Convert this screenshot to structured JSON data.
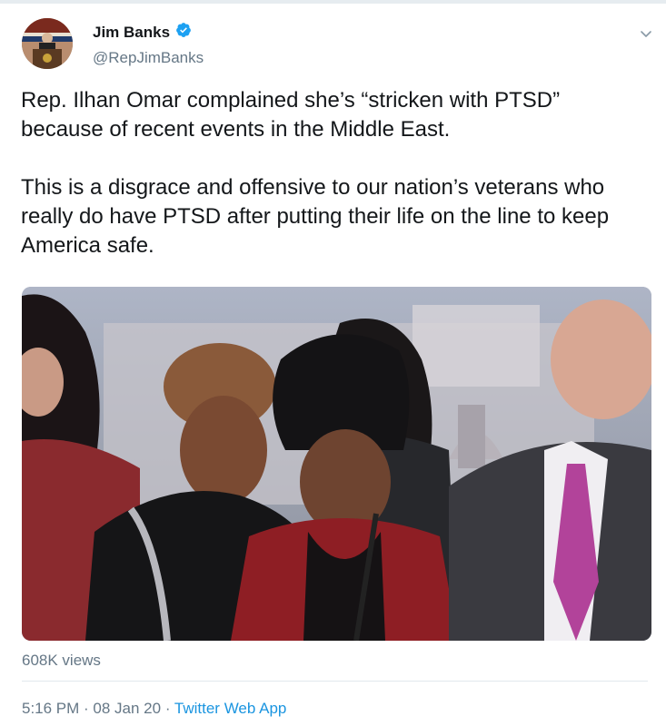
{
  "tweet": {
    "author": {
      "display_name": "Jim Banks",
      "handle": "@RepJimBanks",
      "verified": true
    },
    "text_paragraphs": [
      "Rep. Ilhan Omar complained she’s “stricken with PTSD” because of recent events in the Middle East.",
      "This is a disgrace and offensive to our nation’s veterans who really do have PTSD after putting their life on the line to keep America safe."
    ],
    "views": "608K views",
    "timestamp": "5:16 PM · 08 Jan 20 · ",
    "source_app": "Twitter Web App"
  },
  "colors": {
    "text": "#14171a",
    "secondary": "#657786",
    "link": "#1b95e0",
    "verified": "#1da1f2",
    "divider": "#e1e8ed"
  },
  "icons": {
    "verified": "verified-badge-icon",
    "menu": "chevron-down-icon"
  }
}
